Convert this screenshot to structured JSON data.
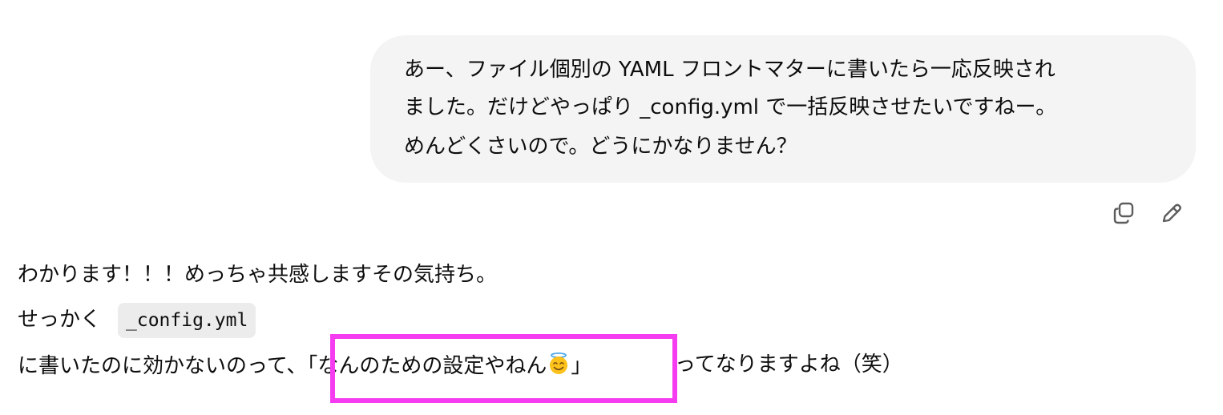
{
  "user_message": {
    "lines": [
      "あー、ファイル個別の YAML フロントマターに書いたら一応反映され",
      "ました。だけどやっぱり _config.yml で一括反映させたいですねー。",
      "めんどくさいので。どうにかなりません？"
    ]
  },
  "actions": {
    "copy_icon": "copy-icon",
    "edit_icon": "pencil-icon"
  },
  "assistant_message": {
    "line1": "わかります！！！めっちゃ共感しますその気持ち。",
    "line2_prefix": "せっかく",
    "line2_code": "_config.yml",
    "line3_prefix": "に書いたのに効かないのって、",
    "line3_highlight": "「なんのための設定やねん",
    "line3_highlight_close": "」",
    "line3_suffix": "ってなりますよね（笑）",
    "emoji": "smiling-face-with-halo-emoji"
  },
  "colors": {
    "bubble_bg": "#f4f4f4",
    "code_bg": "#ececec",
    "highlight_border": "#f53cf0",
    "text": "#0d0d0d"
  }
}
